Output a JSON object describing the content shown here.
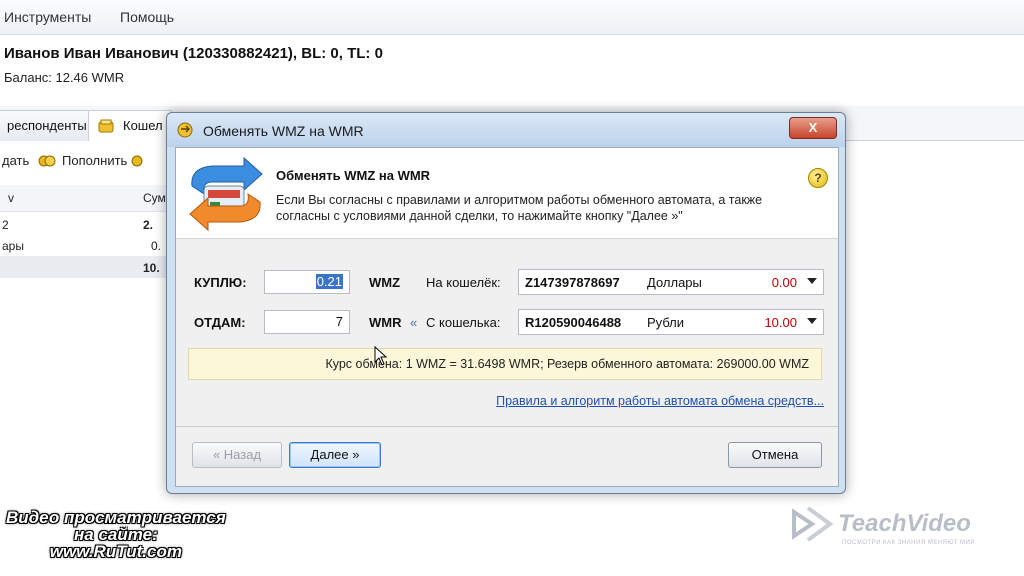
{
  "menu": {
    "items": [
      "Инструменты",
      "Помощь"
    ]
  },
  "user": {
    "name": "Иванов Иван Иванович (120330882421), BL: 0, TL: 0",
    "balance": "Баланс: 12.46 WMR"
  },
  "tabs": [
    {
      "label": "респонденты"
    },
    {
      "label": "Кошел"
    }
  ],
  "toolbar": {
    "left_label": "дать",
    "topup_label": "Пополнить"
  },
  "grid": {
    "col1": "v",
    "col2": "Сум",
    "rows": [
      {
        "a": "2",
        "b": "2."
      },
      {
        "a": "ары",
        "b": "0."
      },
      {
        "a": "",
        "b": "10."
      }
    ]
  },
  "dialog": {
    "title": "Обменять WMZ на  WMR",
    "close_label": "X",
    "header_title": "Обменять WMZ на  WMR",
    "header_desc": "Если Вы согласны с правилами и алгоритмом работы обменного автомата, а также согласны с условиями данной сделки, то нажимайте кнопку \"Далее »\"",
    "help_label": "?",
    "buy": {
      "label": "КУПЛЮ:",
      "value": "0.21",
      "currency": "WMZ",
      "wallet_label": "На кошелёк:",
      "wallet_id": "Z147397878697",
      "wallet_name": "Доллары",
      "wallet_amount": "0.00"
    },
    "give": {
      "label": "ОТДАМ:",
      "value": "7",
      "currency": "WMR",
      "arrow": "«",
      "wallet_label": "С кошелька:",
      "wallet_id": "R120590046488",
      "wallet_name": "Рубли",
      "wallet_amount": "10.00"
    },
    "rate_text": "Курс обмена: 1 WMZ = 31.6498 WMR; Резерв обменного автомата: 269000.00 WMZ",
    "rules_link": "Правила и алгоритм работы автомата обмена средств...",
    "back_label": "« Назад",
    "next_label": "Далее »",
    "cancel_label": "Отмена"
  },
  "watermark": {
    "line1": "Видео просматривается",
    "line2": "на сайте:",
    "line3": "www.RuTut.com",
    "brand": "TeachVideo",
    "slogan": "ПОСМОТРИ КАК ЗНАНИЯ МЕНЯЮТ МИР"
  },
  "colors": {
    "accent": "#3a74c8",
    "amount_red": "#c00000",
    "link": "#1f4fb0",
    "rate_band": "#fdf7d9"
  }
}
